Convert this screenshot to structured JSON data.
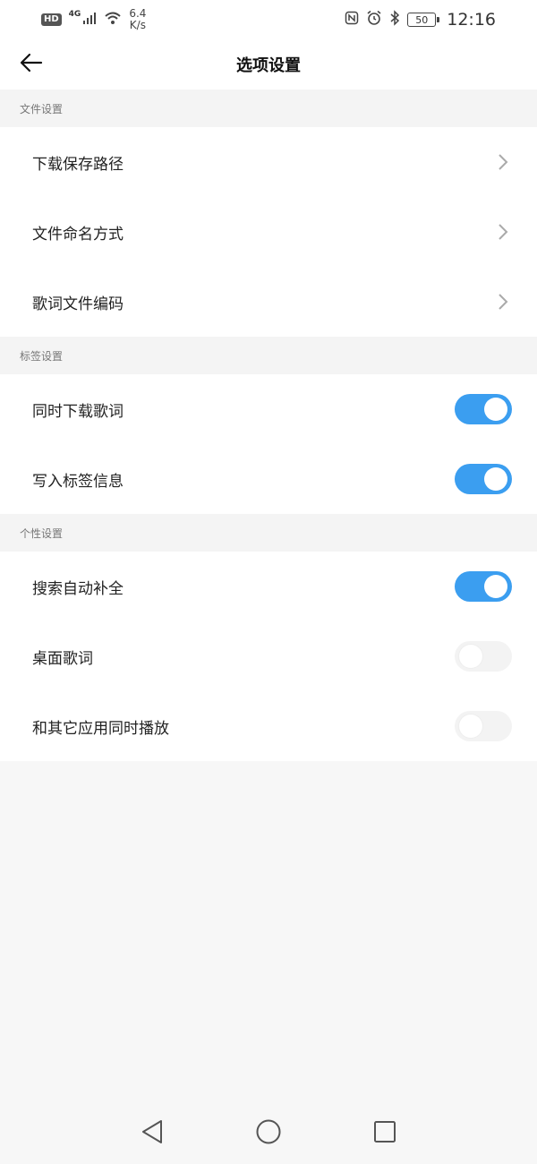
{
  "status_bar": {
    "hd_label": "HD",
    "network_label": "4G",
    "speed_value": "6.4",
    "speed_unit": "K/s",
    "battery_level": "50",
    "time": "12:16"
  },
  "header": {
    "title": "选项设置"
  },
  "sections": [
    {
      "title": "文件设置",
      "items": [
        {
          "label": "下载保存路径",
          "control": "chevron"
        },
        {
          "label": "文件命名方式",
          "control": "chevron"
        },
        {
          "label": "歌词文件编码",
          "control": "chevron"
        }
      ]
    },
    {
      "title": "标签设置",
      "items": [
        {
          "label": "同时下载歌词",
          "control": "toggle",
          "on": true
        },
        {
          "label": "写入标签信息",
          "control": "toggle",
          "on": true
        }
      ]
    },
    {
      "title": "个性设置",
      "items": [
        {
          "label": "搜索自动补全",
          "control": "toggle",
          "on": true
        },
        {
          "label": "桌面歌词",
          "control": "toggle",
          "on": false
        },
        {
          "label": "和其它应用同时播放",
          "control": "toggle",
          "on": false
        }
      ]
    }
  ],
  "colors": {
    "accent": "#3b9ef0",
    "toggle_off": "#f3f3f3"
  },
  "icons": {
    "back": "arrow-left-icon",
    "chevron": "chevron-right-icon",
    "nav_back": "triangle-back-icon",
    "nav_home": "circle-home-icon",
    "nav_recent": "square-recent-icon"
  }
}
